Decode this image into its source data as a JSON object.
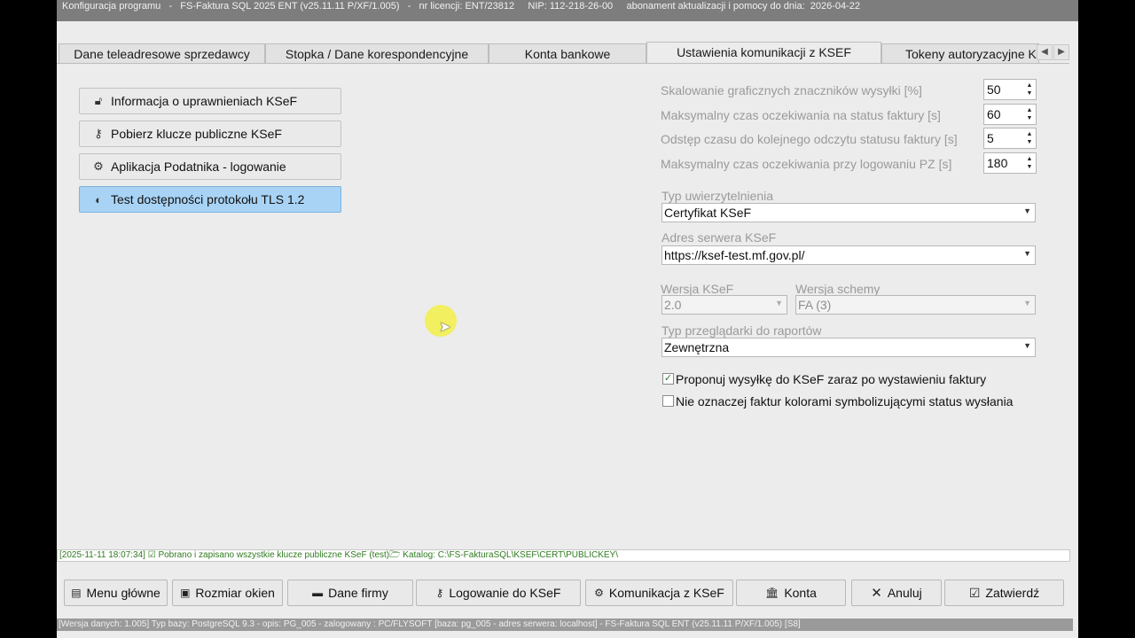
{
  "titlebar": {
    "text": "Konfiguracja programu   -   FS-Faktura SQL 2025 ENT (v25.11.11 P/XF/1.005)   -   nr licencji: ENT/23812     NIP: 112-218-26-00     abonament aktualizacji i pomocy do dnia:  2026-04-22"
  },
  "tabs": [
    {
      "label": "Dane teleadresowe sprzedawcy"
    },
    {
      "label": "Stopka / Dane korespondencyjne"
    },
    {
      "label": "Konta bankowe"
    },
    {
      "label": "Ustawienia komunikacji z KSEF"
    },
    {
      "label": "Tokeny autoryzacyjne KSeF"
    }
  ],
  "left_buttons": [
    {
      "label": "Informacja o uprawnieniach KSeF",
      "icon": "lock-icon"
    },
    {
      "label": "Pobierz klucze publiczne KSeF",
      "icon": "key-icon"
    },
    {
      "label": "Aplikacja Podatnika - logowanie",
      "icon": "gear-icon"
    },
    {
      "label": "Test dostępności protokołu TLS 1.2",
      "icon": "half-circle-icon"
    }
  ],
  "settings": {
    "scaling_label": "Skalowanie graficznych znaczników wysyłki [%]",
    "scaling_value": "50",
    "max_status_label": "Maksymalny czas oczekiwania na status faktury [s]",
    "max_status_value": "60",
    "interval_label": "Odstęp czasu do kolejnego odczytu statusu faktury [s]",
    "interval_value": "5",
    "login_label": "Maksymalny czas oczekiwania przy logowaniu PZ [s]",
    "login_value": "180",
    "auth_type_label": "Typ uwierzytelnienia",
    "auth_type_value": "Certyfikat KSeF",
    "server_label": "Adres serwera KSeF",
    "server_value": "https://ksef-test.mf.gov.pl/",
    "ksef_version_label": "Wersja KSeF",
    "ksef_version_value": "2.0",
    "schema_version_label": "Wersja schemy",
    "schema_version_value": "FA (3)",
    "browser_label": "Typ przeglądarki do raportów",
    "browser_value": "Zewnętrzna",
    "check1_label": "Proponuj wysyłkę do KSeF zaraz po wystawieniu faktury",
    "check1_checked": true,
    "check2_label": "Nie oznaczej faktur kolorami symbolizującymi status wysłania",
    "check2_checked": false
  },
  "status_line": "[2025-11-11 18:07:34]   ☑ Pobrano i zapisano wszystkie klucze publiczne KSeF (test)🗁 Katalog: C:\\FS-FakturaSQL\\KSEF\\CERT\\PUBLICKEY\\",
  "bottom_buttons": [
    {
      "label": "Menu główne",
      "icon": "menu-icon"
    },
    {
      "label": "Rozmiar okien",
      "icon": "window-size-icon"
    },
    {
      "label": "Dane firmy",
      "icon": "company-icon"
    },
    {
      "label": "Logowanie do KSeF",
      "icon": "key-icon"
    },
    {
      "label": "Komunikacja z KSeF",
      "icon": "gear-icon"
    },
    {
      "label": "Konta",
      "icon": "bank-icon"
    },
    {
      "label": "Anuluj",
      "icon": "close-icon"
    },
    {
      "label": "Zatwierdź",
      "icon": "check-icon"
    }
  ],
  "footer": "[Wersja danych: 1.005] Typ bazy: PostgreSQL 9.3 - opis: PG_005 - zalogowany : PC/FLYSOFT [baza: pg_005 - adres serwera: localhost]  -  FS-Faktura SQL ENT (v25.11.11 P/XF/1.005) [S8]"
}
